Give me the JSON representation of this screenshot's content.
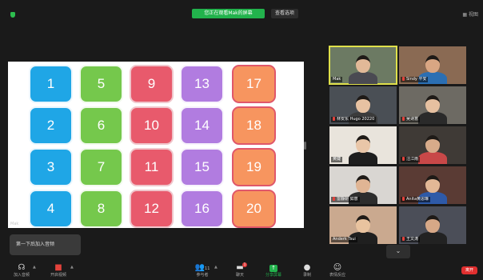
{
  "header": {
    "share_banner": "您正在观看Mak的屏幕",
    "view_options": "查看选项",
    "view_toggle": "视图"
  },
  "shared_screen": {
    "tiles": [
      {
        "number": "1",
        "color": "blue"
      },
      {
        "number": "2",
        "color": "blue"
      },
      {
        "number": "3",
        "color": "blue"
      },
      {
        "number": "4",
        "color": "blue"
      },
      {
        "number": "5",
        "color": "green"
      },
      {
        "number": "6",
        "color": "green"
      },
      {
        "number": "7",
        "color": "green"
      },
      {
        "number": "8",
        "color": "green"
      },
      {
        "number": "9",
        "color": "red"
      },
      {
        "number": "10",
        "color": "red"
      },
      {
        "number": "11",
        "color": "red"
      },
      {
        "number": "12",
        "color": "red"
      },
      {
        "number": "13",
        "color": "purple"
      },
      {
        "number": "14",
        "color": "purple"
      },
      {
        "number": "15",
        "color": "purple"
      },
      {
        "number": "16",
        "color": "purple"
      },
      {
        "number": "17",
        "color": "orange"
      },
      {
        "number": "18",
        "color": "orange"
      },
      {
        "number": "19",
        "color": "orange"
      },
      {
        "number": "20",
        "color": "orange"
      }
    ],
    "watermark": "Mak"
  },
  "toast": "第一下后加入音频",
  "participants": [
    {
      "name": "Mak",
      "muted": false,
      "active": true
    },
    {
      "name": "Sindy 平安",
      "muted": true
    },
    {
      "name": "林安东 Hugo 20220",
      "muted": true
    },
    {
      "name": "吴诗意",
      "muted": true
    },
    {
      "name": "黄婕",
      "muted": false
    },
    {
      "name": "汪江雨",
      "muted": true
    },
    {
      "name": "雷静妍 如意",
      "muted": true
    },
    {
      "name": "Anita黄思琳",
      "muted": true
    },
    {
      "name": "Anderk Tsui",
      "muted": false
    },
    {
      "name": "王文涛",
      "muted": true
    }
  ],
  "collapse_icon": "chevron-down-icon",
  "toolbar": {
    "audio": "加入音频",
    "video": "开启视频",
    "participants": "参与者",
    "participants_count": "11",
    "chat": "聊天",
    "chat_badge": "1",
    "share": "分享屏幕",
    "record": "录制",
    "reactions": "表情反应",
    "leave": "离开"
  },
  "colors": {
    "blue": "#1fa6e6",
    "green": "#75c84c",
    "red": "#e85a6c",
    "purple": "#b17ce0",
    "orange": "#f7955f",
    "banner_green": "#22b24c",
    "leave_red": "#e02f2f"
  }
}
